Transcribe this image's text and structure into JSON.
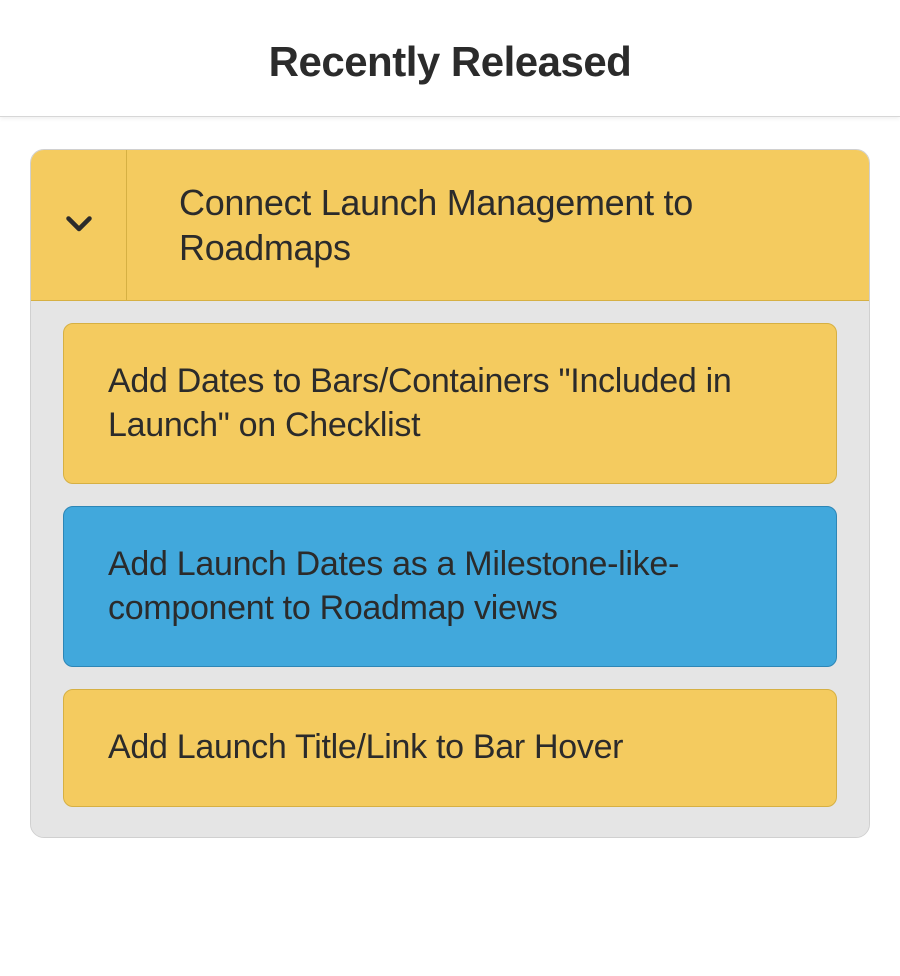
{
  "header": {
    "title": "Recently Released"
  },
  "group": {
    "title": "Connect Launch Management to Roadmaps",
    "chevron_icon": "chevron-down-icon"
  },
  "cards": [
    {
      "label": "Add Dates to Bars/Containers \"Included in Launch\" on Checklist",
      "variant": "yellow"
    },
    {
      "label": "Add Launch Dates as a Milestone-like-component to Roadmap views",
      "variant": "blue"
    },
    {
      "label": "Add Launch Title/Link to Bar Hover",
      "variant": "yellow"
    }
  ],
  "colors": {
    "yellow": "#f4cb5f",
    "blue": "#41a8dc",
    "panel": "#e5e5e5"
  }
}
